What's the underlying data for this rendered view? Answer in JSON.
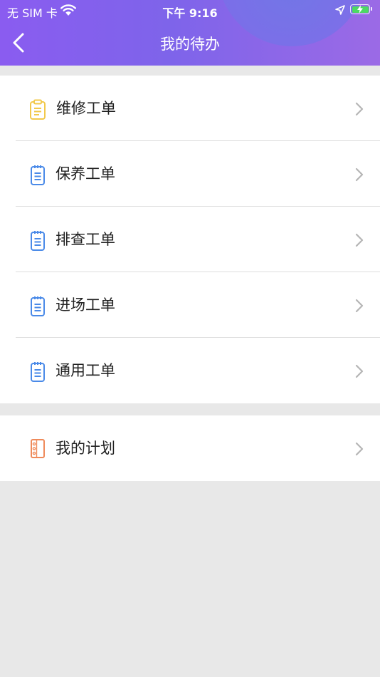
{
  "status_bar": {
    "carrier": "无 SIM 卡",
    "time": "下午 9:16"
  },
  "header": {
    "title": "我的待办"
  },
  "colors": {
    "header_gradient_start": "#8a5cf0",
    "header_gradient_end": "#9b6ae6",
    "icon_yellow": "#f2c94c",
    "icon_blue": "#4a8ae8",
    "icon_orange": "#ef8a5a",
    "battery_green": "#4cd964",
    "chevron_gray": "#b5b5b5"
  },
  "work_orders": {
    "items": [
      {
        "label": "维修工单",
        "icon": "clipboard-icon",
        "icon_color": "#f2c94c"
      },
      {
        "label": "保养工单",
        "icon": "notepad-icon",
        "icon_color": "#4a8ae8"
      },
      {
        "label": "排查工单",
        "icon": "notepad-icon",
        "icon_color": "#4a8ae8"
      },
      {
        "label": "进场工单",
        "icon": "notepad-icon",
        "icon_color": "#4a8ae8"
      },
      {
        "label": "通用工单",
        "icon": "notepad-icon",
        "icon_color": "#4a8ae8"
      }
    ]
  },
  "plans": {
    "items": [
      {
        "label": "我的计划",
        "icon": "notebook-icon",
        "icon_color": "#ef8a5a"
      }
    ]
  }
}
